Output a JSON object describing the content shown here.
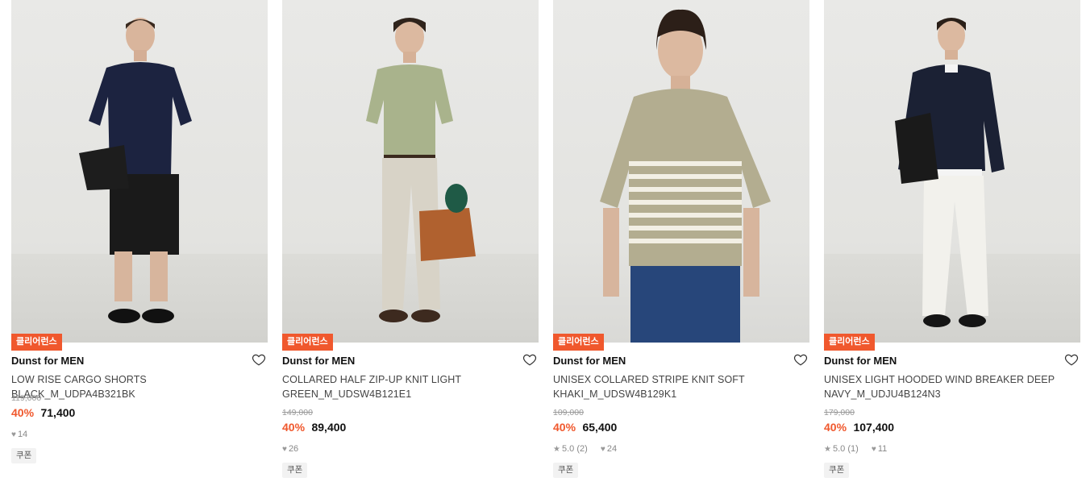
{
  "products": [
    {
      "badge": "클리어런스",
      "brand": "Dunst for MEN",
      "name": "LOW RISE CARGO SHORTS BLACK_M_UDPA4B321BK",
      "original_price": "119,000",
      "discount": "40%",
      "sale_price": "71,400",
      "likes": "14",
      "coupon": "쿠폰",
      "colors": {
        "top": "#1c2340",
        "bottom": "#1a1a1a",
        "bag": "#1d1d1d"
      }
    },
    {
      "badge": "클리어런스",
      "brand": "Dunst for MEN",
      "name": "COLLARED HALF ZIP-UP KNIT LIGHT GREEN_M_UDSW4B121E1",
      "original_price": "149,000",
      "discount": "40%",
      "sale_price": "89,400",
      "likes": "26",
      "coupon": "쿠폰",
      "colors": {
        "top": "#a9b38c",
        "bottom": "#d8d3c7",
        "bag": "#b0612f"
      }
    },
    {
      "badge": "클리어런스",
      "brand": "Dunst for MEN",
      "name": "UNISEX COLLARED STRIPE KNIT SOFT KHAKI_M_UDSW4B129K1",
      "original_price": "109,000",
      "discount": "40%",
      "sale_price": "65,400",
      "rating": "5.0",
      "review_count": "(2)",
      "likes": "24",
      "coupon": "쿠폰",
      "colors": {
        "top": "#b3ad90",
        "bottom": "#27467a",
        "bag": ""
      }
    },
    {
      "badge": "클리어런스",
      "brand": "Dunst for MEN",
      "name": "UNISEX LIGHT HOODED WIND BREAKER DEEP NAVY_M_UDJU4B124N3",
      "original_price": "179,000",
      "discount": "40%",
      "sale_price": "107,400",
      "rating": "5.0",
      "review_count": "(1)",
      "likes": "11",
      "coupon": "쿠폰",
      "colors": {
        "top": "#1b2134",
        "bottom": "#f2f1ec",
        "bag": "#1a1a1a"
      }
    }
  ],
  "icons": {
    "wishlist": "heart-outline-icon",
    "like": "heart-icon",
    "rating": "star-icon"
  }
}
